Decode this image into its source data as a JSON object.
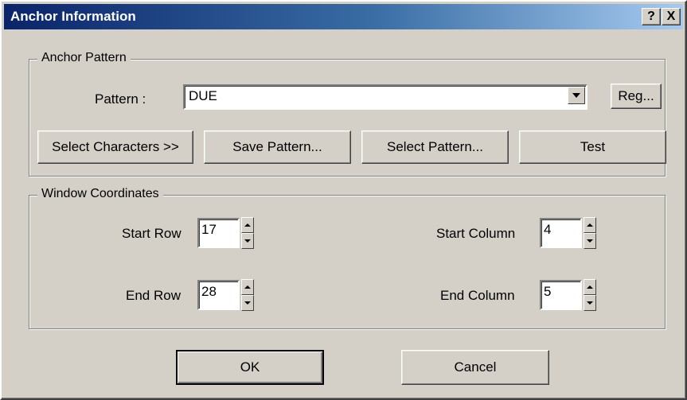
{
  "window": {
    "title": "Anchor Information",
    "help_button": "?",
    "close_button": "X"
  },
  "anchor_pattern": {
    "group_title": "Anchor Pattern",
    "pattern_label": "Pattern :",
    "pattern_value": "DUE",
    "reg_button": "Reg...",
    "select_characters_button": "Select Characters >>",
    "save_pattern_button": "Save Pattern...",
    "select_pattern_button": "Select Pattern...",
    "test_button": "Test"
  },
  "window_coordinates": {
    "group_title": "Window Coordinates",
    "start_row_label": "Start Row",
    "start_row_value": "17",
    "end_row_label": "End Row",
    "end_row_value": "28",
    "start_column_label": "Start Column",
    "start_column_value": "4",
    "end_column_label": "End Column",
    "end_column_value": "5"
  },
  "footer": {
    "ok_button": "OK",
    "cancel_button": "Cancel"
  }
}
